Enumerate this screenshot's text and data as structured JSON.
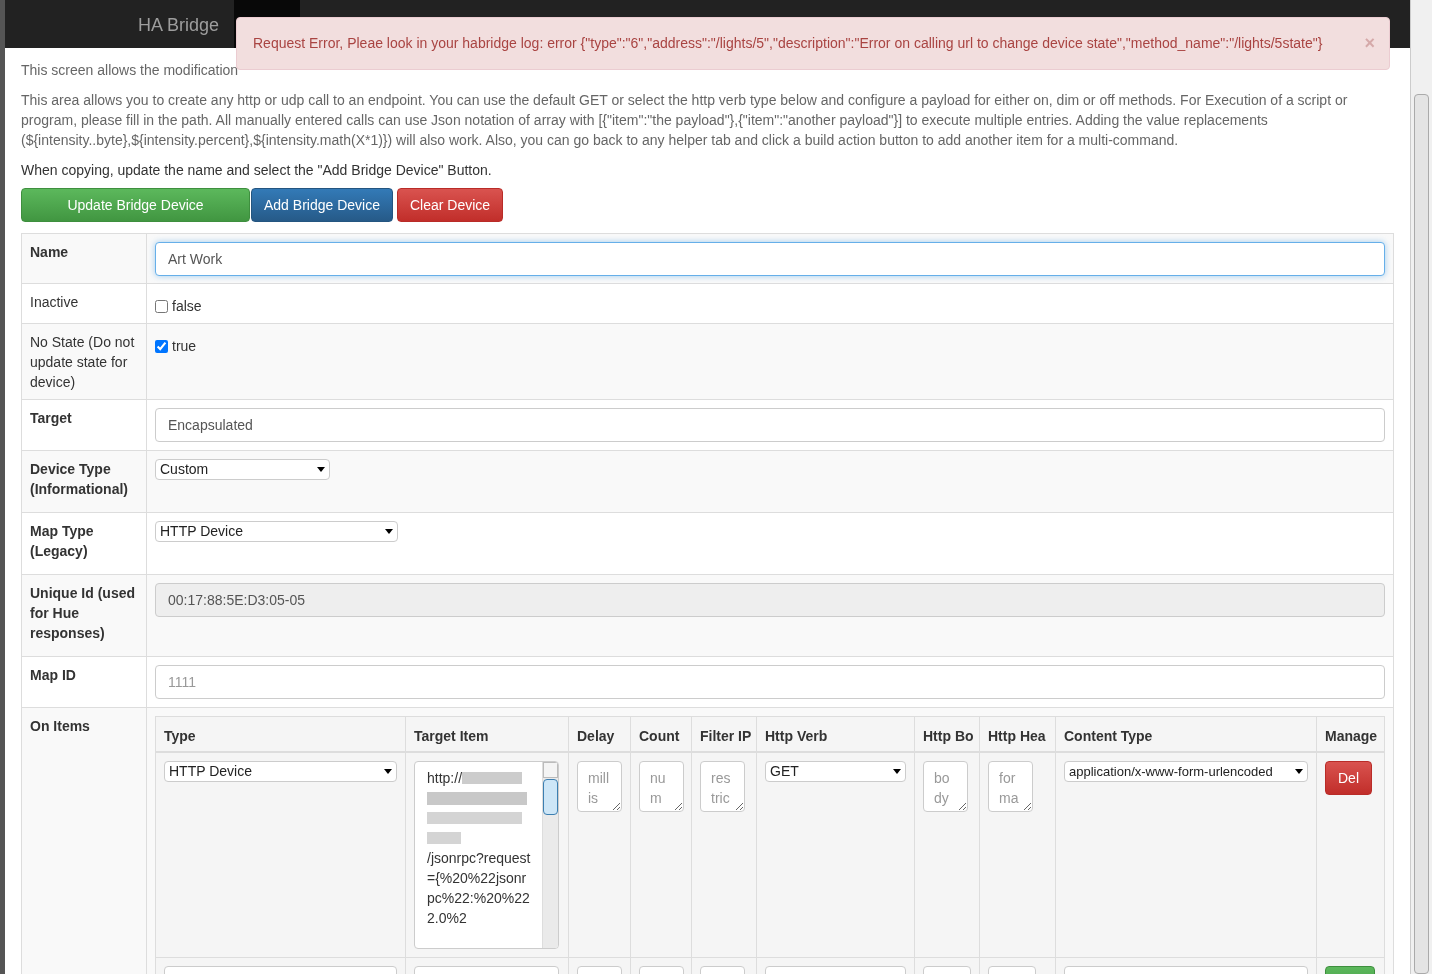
{
  "navbar": {
    "brand": "HA Bridge"
  },
  "alert": {
    "text": "Request Error, Pleae look in your habridge log: error {\"type\":\"6\",\"address\":\"/lights/5\",\"description\":\"Error on calling url to change device state\",\"method_name\":\"/lights/5state\"}",
    "close": "×"
  },
  "intro": [
    "This screen allows the modification",
    "This area allows you to create any http or udp call to an endpoint. You can use the default GET or select the http verb type below and configure a payload for either on, dim or off methods. For Execution of a script or program, please fill in the path. All manually entered calls can use Json notation of array with [{\"item\":\"the payload\"},{\"item\":\"another payload\"}] to execute multiple entries. Adding the value replacements (${intensity..byte},${intensity.percent},${intensity.math(X*1)}) will also work. Also, you can go back to any helper tab and click a build action button to add another item for a multi-command."
  ],
  "note": "When copying, update the name and select the \"Add Bridge Device\" Button.",
  "buttons": [
    {
      "label": "Update Bridge Device",
      "kind": "success"
    },
    {
      "label": "Add Bridge Device",
      "kind": "primary"
    },
    {
      "label": "Clear Device",
      "kind": "danger"
    }
  ],
  "fields": [
    {
      "label": "Name",
      "bold": true,
      "kind": "text",
      "value": "Art Work",
      "focused": true
    },
    {
      "label": "Inactive",
      "bold": false,
      "kind": "checkbox",
      "checked": false,
      "value": "false"
    },
    {
      "label": "No State (Do not update state for device)",
      "bold": false,
      "kind": "checkbox",
      "checked": true,
      "value": "true"
    },
    {
      "label": "Target",
      "bold": true,
      "kind": "text",
      "value": "Encapsulated",
      "focused": false
    },
    {
      "label": "Device Type (Informational)",
      "bold": true,
      "kind": "select",
      "value": "Custom"
    },
    {
      "label": "Map Type (Legacy)",
      "bold": true,
      "kind": "select",
      "value": "HTTP Device"
    },
    {
      "label": "Unique Id (used for Hue responses)",
      "bold": true,
      "kind": "readonly",
      "value": "00:17:88:5E:D3:05-05"
    },
    {
      "label": "Map ID",
      "bold": true,
      "kind": "placeholder",
      "placeholder": "1111"
    }
  ],
  "on_items": {
    "label": "On Items",
    "columns": [
      "Type",
      "Target Item",
      "Delay",
      "Count",
      "Filter IP",
      "Http Verb",
      "Http Bo",
      "Http Hea",
      "Content Type",
      "Manage"
    ],
    "rows": [
      {
        "kind": "existing",
        "type": "HTTP Device",
        "target_start": "http://",
        "target_end": "/jsonrpc?request={%20%22jsonrpc%22:%20%222.0%2",
        "delay_placeholder": "millis",
        "count_placeholder": "num",
        "filter_placeholder": "restric",
        "verb": "GET",
        "body_placeholder": "body",
        "headers_placeholder": "forma",
        "content_type": "application/x-www-form-urlencoded",
        "action": "Del"
      },
      {
        "kind": "new"
      }
    ]
  }
}
